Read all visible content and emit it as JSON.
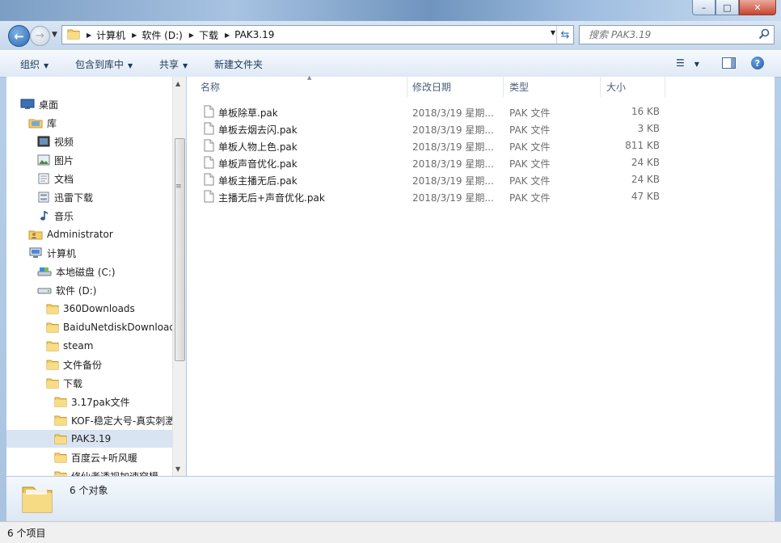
{
  "window": {
    "caption_buttons": [
      "–",
      "□",
      "✕"
    ]
  },
  "address_bar": {
    "crumbs": [
      "计算机",
      "软件 (D:)",
      "下载",
      "PAK3.19"
    ]
  },
  "search": {
    "placeholder": "搜索 PAK3.19"
  },
  "toolbar": {
    "organize": "组织",
    "include_in_library": "包含到库中",
    "share": "共享",
    "new_folder": "新建文件夹"
  },
  "nav_tree": [
    {
      "label": "桌面",
      "icon": "desktop-icon"
    },
    {
      "label": "库",
      "icon": "library-icon"
    },
    {
      "label": "视频",
      "icon": "video-icon"
    },
    {
      "label": "图片",
      "icon": "picture-icon"
    },
    {
      "label": "文档",
      "icon": "document-icon"
    },
    {
      "label": "迅雷下载",
      "icon": "download-icon"
    },
    {
      "label": "音乐",
      "icon": "music-icon"
    },
    {
      "label": "Administrator",
      "icon": "user-folder-icon"
    },
    {
      "label": "计算机",
      "icon": "computer-icon"
    },
    {
      "label": "本地磁盘 (C:)",
      "icon": "drive-icon"
    },
    {
      "label": "软件 (D:)",
      "icon": "drive-icon"
    },
    {
      "label": "360Downloads",
      "icon": "folder-icon"
    },
    {
      "label": "BaiduNetdiskDownload",
      "icon": "folder-icon"
    },
    {
      "label": "steam",
      "icon": "folder-icon"
    },
    {
      "label": "文件备份",
      "icon": "folder-icon"
    },
    {
      "label": "下载",
      "icon": "folder-icon"
    },
    {
      "label": "3.17pak文件",
      "icon": "folder-icon"
    },
    {
      "label": "KOF-稳定大号-真实刺激",
      "icon": "folder-icon"
    },
    {
      "label": "PAK3.19",
      "icon": "folder-icon"
    },
    {
      "label": "百度云+听风暖",
      "icon": "folder-icon"
    },
    {
      "label": "修仙者透视加速穿模",
      "icon": "folder-icon"
    }
  ],
  "columns": {
    "name": "名称",
    "date": "修改日期",
    "type": "类型",
    "size": "大小"
  },
  "files": [
    {
      "name": "单板除草.pak",
      "date": "2018/3/19 星期...",
      "type": "PAK 文件",
      "size": "16 KB"
    },
    {
      "name": "单板去烟去闪.pak",
      "date": "2018/3/19 星期...",
      "type": "PAK 文件",
      "size": "3 KB"
    },
    {
      "name": "单板人物上色.pak",
      "date": "2018/3/19 星期...",
      "type": "PAK 文件",
      "size": "811 KB"
    },
    {
      "name": "单板声音优化.pak",
      "date": "2018/3/19 星期...",
      "type": "PAK 文件",
      "size": "24 KB"
    },
    {
      "name": "单板主播无后.pak",
      "date": "2018/3/19 星期...",
      "type": "PAK 文件",
      "size": "24 KB"
    },
    {
      "name": "主播无后+声音优化.pak",
      "date": "2018/3/19 星期...",
      "type": "PAK 文件",
      "size": "47 KB"
    }
  ],
  "details_pane": {
    "summary": "6 个对象"
  },
  "status_bar": {
    "text": "6 个项目"
  }
}
